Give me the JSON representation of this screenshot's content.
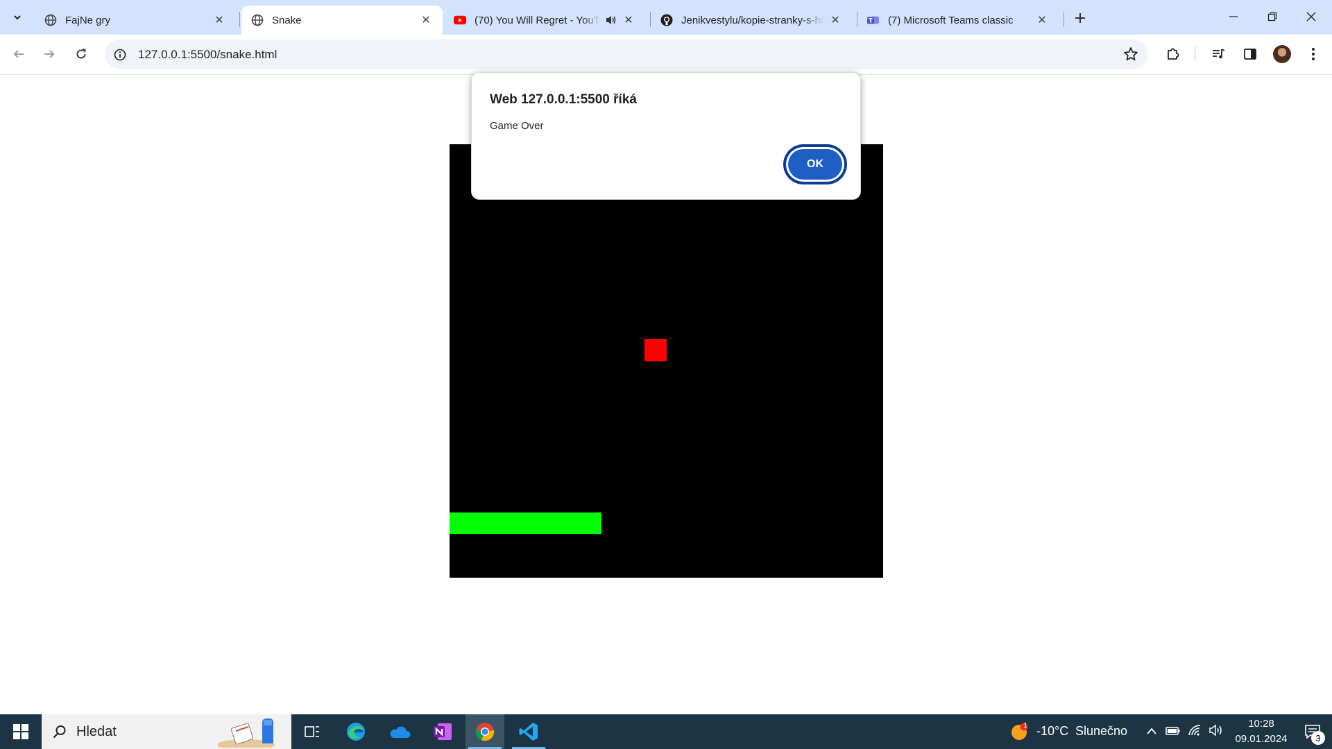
{
  "browser": {
    "tabs": [
      {
        "title": "FajNe gry",
        "favicon": "globe-icon",
        "active": false
      },
      {
        "title": "Snake",
        "favicon": "globe-icon",
        "active": true
      },
      {
        "title": "(70) You Will Regret - YouTube",
        "favicon": "youtube-icon",
        "active": false,
        "audio": true
      },
      {
        "title": "Jenikvestylu/kopie-stranky-s-hrami",
        "favicon": "github-icon",
        "active": false
      },
      {
        "title": "(7) Microsoft Teams classic",
        "favicon": "teams-icon",
        "active": false
      }
    ],
    "address": "127.0.0.1:5500/snake.html"
  },
  "game": {
    "canvas_color": "#000000",
    "snake_color": "#00ff00",
    "food_color": "#ff0000"
  },
  "dialog": {
    "title": "Web 127.0.0.1:5500 říká",
    "message": "Game Over",
    "ok_label": "OK"
  },
  "taskbar": {
    "search_placeholder": "Hledat",
    "weather_temp": "-10°C",
    "weather_text": "Slunečno",
    "weather_badge": "1",
    "time": "10:28",
    "date": "09.01.2024",
    "notifications": "3",
    "apps": [
      "task-view-icon",
      "edge-icon",
      "onedrive-icon",
      "onenote-icon",
      "chrome-icon",
      "vscode-icon"
    ]
  }
}
